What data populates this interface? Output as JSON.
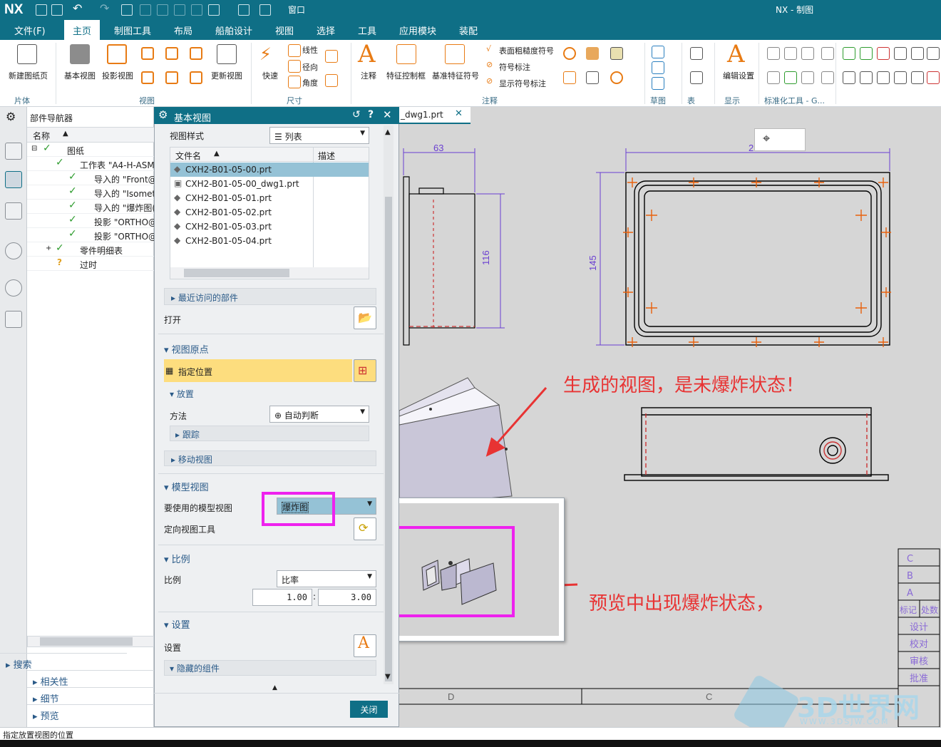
{
  "app": {
    "logo": "NX",
    "window_title": "NX - 制图",
    "window_menu": "窗口"
  },
  "menu": [
    "文件(F)",
    "主页",
    "制图工具",
    "布局",
    "船舶设计",
    "视图",
    "选择",
    "工具",
    "应用模块",
    "装配"
  ],
  "ribbon": {
    "sheet_group": {
      "new_sheet": "新建图纸页",
      "label": "片体"
    },
    "view_group": {
      "base_view": "基本视图",
      "projected_view": "投影视图",
      "update_view": "更新视图",
      "label": "视图"
    },
    "dim_group": {
      "quick": "快速",
      "linear": "线性",
      "radial": "径向",
      "angular": "角度",
      "label": "尺寸"
    },
    "annot_group": {
      "note": "注释",
      "fcf": "特征控制框",
      "datum": "基准特征符号",
      "surface": "表面粗糙度符号",
      "symbol": "符号标注",
      "show_symbol": "显示符号标注",
      "label": "注释"
    },
    "sketch_label": "草图",
    "table_label": "表",
    "edit_settings": "编辑设置",
    "display_label": "显示",
    "std_tools": "标准化工具 - G..."
  },
  "navigator": {
    "title": "部件导航器",
    "col_name": "名称",
    "items": [
      {
        "text": "图纸"
      },
      {
        "text": "工作表 \"A4-H-ASM"
      },
      {
        "text": "导入的 \"Front@"
      },
      {
        "text": "导入的 \"Isomet"
      },
      {
        "text": "导入的 \"爆炸图("
      },
      {
        "text": "投影 \"ORTHO@"
      },
      {
        "text": "投影 \"ORTHO@"
      },
      {
        "text": "零件明细表"
      },
      {
        "text": "过时"
      }
    ],
    "sections": [
      "搜索",
      "相关性",
      "细节",
      "预览"
    ]
  },
  "dialog": {
    "title": "基本视图",
    "view_style_label": "视图样式",
    "view_style_value": "列表",
    "file_col": "文件名",
    "desc_col": "描述",
    "files": [
      "CXH2-B01-05-00.prt",
      "CXH2-B01-05-00_dwg1.prt",
      "CXH2-B01-05-01.prt",
      "CXH2-B01-05-02.prt",
      "CXH2-B01-05-03.prt",
      "CXH2-B01-05-04.prt"
    ],
    "recent": "最近访问的部件",
    "open": "打开",
    "origin_section": "视图原点",
    "specify_location": "指定位置",
    "placement": "放置",
    "method_label": "方法",
    "method_value": "自动判断",
    "track": "跟踪",
    "move_view": "移动视图",
    "model_view_section": "模型视图",
    "model_view_label": "要使用的模型视图",
    "model_view_value": "爆炸图",
    "orient_tool": "定向视图工具",
    "scale_section": "比例",
    "scale_label": "比例",
    "scale_value": "比率",
    "scale_num": "1.00",
    "scale_den": "3.00",
    "settings_section": "设置",
    "settings_label": "设置",
    "hidden_components": "隐藏的组件",
    "close": "关闭"
  },
  "drawing": {
    "tab": "_dwg1.prt",
    "dim_63": "63",
    "dim_116": "116",
    "dim_145": "145",
    "dim_2": "2",
    "annotation1": "生成的视图，是未爆炸状态！",
    "annotation2": "预览中出现爆炸状态，",
    "zone_d": "D",
    "zone_c": "C",
    "title_rows": [
      "C",
      "B",
      "A",
      "标记",
      "设计",
      "校对",
      "审核",
      "批准"
    ],
    "title_col2": "处数",
    "watermark": "3D世界网",
    "watermark_url": "WWW.3DSJW.COM"
  },
  "status": "指定放置视图的位置",
  "colors": {
    "accent": "#0f6f86",
    "highlight": "#ee22ee",
    "annotation": "#e83333",
    "selected_row": "#95c2d6",
    "yellow": "#fddd7e"
  }
}
